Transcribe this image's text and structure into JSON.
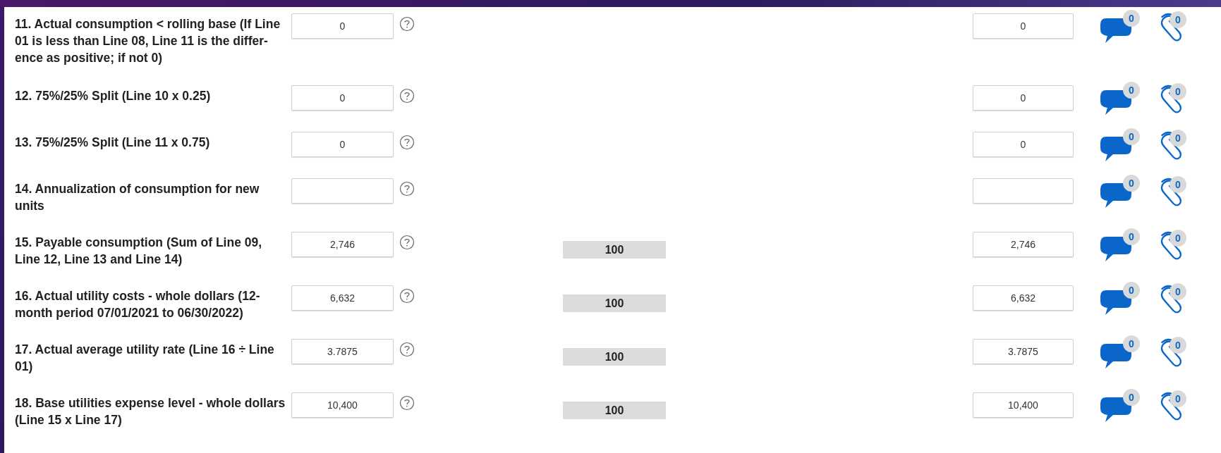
{
  "rows": [
    {
      "label_lines": [
        "11. Actual consumption < rolling base (If Line",
        "01 is less than Line 08, Line 11 is the differ-",
        "ence as positive; if not 0)"
      ],
      "value": "0",
      "adjusted_value": "0",
      "comments": "0",
      "attachments": "0"
    },
    {
      "label_lines": [
        "12. 75%/25% Split (Line 10 x 0.25)"
      ],
      "value": "0",
      "adjusted_value": "0",
      "comments": "0",
      "attachments": "0"
    },
    {
      "label_lines": [
        "13. 75%/25% Split (Line 11 x 0.75)"
      ],
      "value": "0",
      "adjusted_value": "0",
      "comments": "0",
      "attachments": "0"
    },
    {
      "label_lines": [
        "14. Annualization of consumption for new",
        "units"
      ],
      "comments": "0",
      "attachments": "0"
    },
    {
      "label_lines": [
        "15. Payable consumption (Sum of Line 09,",
        "Line 12, Line 13 and Line 14)"
      ],
      "value": "2,746",
      "percent": "100",
      "adjusted_value": "2,746",
      "comments": "0",
      "attachments": "0"
    },
    {
      "label_lines": [
        "16. Actual utility costs - whole dollars (12-",
        "month period 07/01/2021 to 06/30/2022)"
      ],
      "value": "6,632",
      "percent": "100",
      "adjusted_value": "6,632",
      "comments": "0",
      "attachments": "0"
    },
    {
      "label_lines": [
        "17. Actual average utility rate (Line 16 ÷ Line",
        "01)"
      ],
      "value": "3.7875",
      "percent": "100",
      "adjusted_value": "3.7875",
      "comments": "0",
      "attachments": "0"
    },
    {
      "label_lines": [
        "18. Base utilities expense level - whole dollars",
        "(Line 15 x Line 17)"
      ],
      "value": "10,400",
      "percent": "100",
      "adjusted_value": "10,400",
      "comments": "0",
      "attachments": "0"
    }
  ]
}
